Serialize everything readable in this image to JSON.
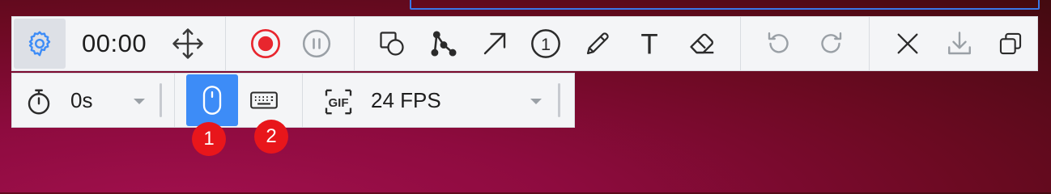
{
  "main_toolbar": {
    "timer": "00:00",
    "buttons": [
      {
        "name": "settings",
        "icon": "gear-icon"
      },
      {
        "name": "move",
        "icon": "move-arrows-icon"
      },
      {
        "name": "record",
        "icon": "record-icon"
      },
      {
        "name": "pause",
        "icon": "pause-icon"
      },
      {
        "name": "shape",
        "icon": "shape-icon"
      },
      {
        "name": "polyline",
        "icon": "polyline-icon"
      },
      {
        "name": "arrow",
        "icon": "arrow-icon"
      },
      {
        "name": "number-marker",
        "icon": "number-circle-icon",
        "text": "1"
      },
      {
        "name": "pen",
        "icon": "pencil-icon"
      },
      {
        "name": "text",
        "icon": "text-icon",
        "text": "T"
      },
      {
        "name": "eraser",
        "icon": "eraser-icon"
      },
      {
        "name": "undo",
        "icon": "undo-icon"
      },
      {
        "name": "redo",
        "icon": "redo-icon"
      },
      {
        "name": "close",
        "icon": "close-icon"
      },
      {
        "name": "download",
        "icon": "download-icon"
      },
      {
        "name": "copy",
        "icon": "copy-icon"
      }
    ]
  },
  "options_toolbar": {
    "delay": {
      "icon": "stopwatch-icon",
      "value": "0s"
    },
    "capture_mouse": {
      "icon": "mouse-icon",
      "active": true
    },
    "capture_keyboard": {
      "icon": "keyboard-icon",
      "active": false
    },
    "format": {
      "icon": "gif-icon",
      "icon_text": "GIF",
      "value": "24 FPS"
    }
  },
  "badges": [
    "1",
    "2"
  ],
  "colors": {
    "accent": "#3d8cf7",
    "record_red": "#e8262e",
    "badge_red": "#e8161b",
    "disabled_gray": "#9aa0a6",
    "selection_frame": "#3a78e8"
  }
}
